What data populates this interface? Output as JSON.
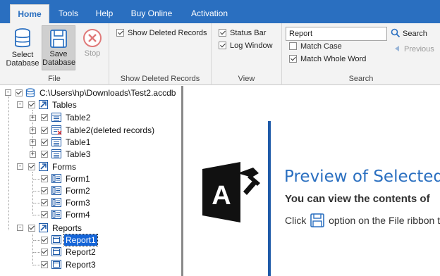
{
  "tabs": [
    {
      "label": "Home",
      "active": true
    },
    {
      "label": "Tools"
    },
    {
      "label": "Help"
    },
    {
      "label": "Buy Online"
    },
    {
      "label": "Activation"
    }
  ],
  "ribbon": {
    "file_group": {
      "label": "File",
      "select_db": "Select Database",
      "save_db": "Save Database",
      "stop": "Stop"
    },
    "show_deleted_group": {
      "label": "Show Deleted Records",
      "checkbox": "Show Deleted Records",
      "checked": true
    },
    "view_group": {
      "label": "View",
      "status_bar": "Status Bar",
      "status_bar_checked": true,
      "log_window": "Log Window",
      "log_window_checked": true
    },
    "search_group": {
      "label": "Search",
      "value": "Report",
      "search_btn": "Search",
      "previous_btn": "Previous",
      "match_case": "Match Case",
      "match_case_checked": false,
      "match_whole_word": "Match Whole Word",
      "match_whole_word_checked": true
    }
  },
  "tree": {
    "root": "C:\\Users\\hp\\Downloads\\Test2.accdb",
    "tables_label": "Tables",
    "tables": [
      "Table2",
      "Table2(deleted records)",
      "Table1",
      "Table3"
    ],
    "forms_label": "Forms",
    "forms": [
      "Form1",
      "Form2",
      "Form3",
      "Form4"
    ],
    "reports_label": "Reports",
    "reports": [
      "Report1",
      "Report2",
      "Report3"
    ],
    "selected": "Report1"
  },
  "preview": {
    "title": "Preview of Selected",
    "subtitle": "You can view the contents of",
    "line_before": "Click",
    "line_after": "option on the File ribbon to"
  },
  "colors": {
    "accent": "#2a6fc0",
    "selection": "#1565d8"
  }
}
